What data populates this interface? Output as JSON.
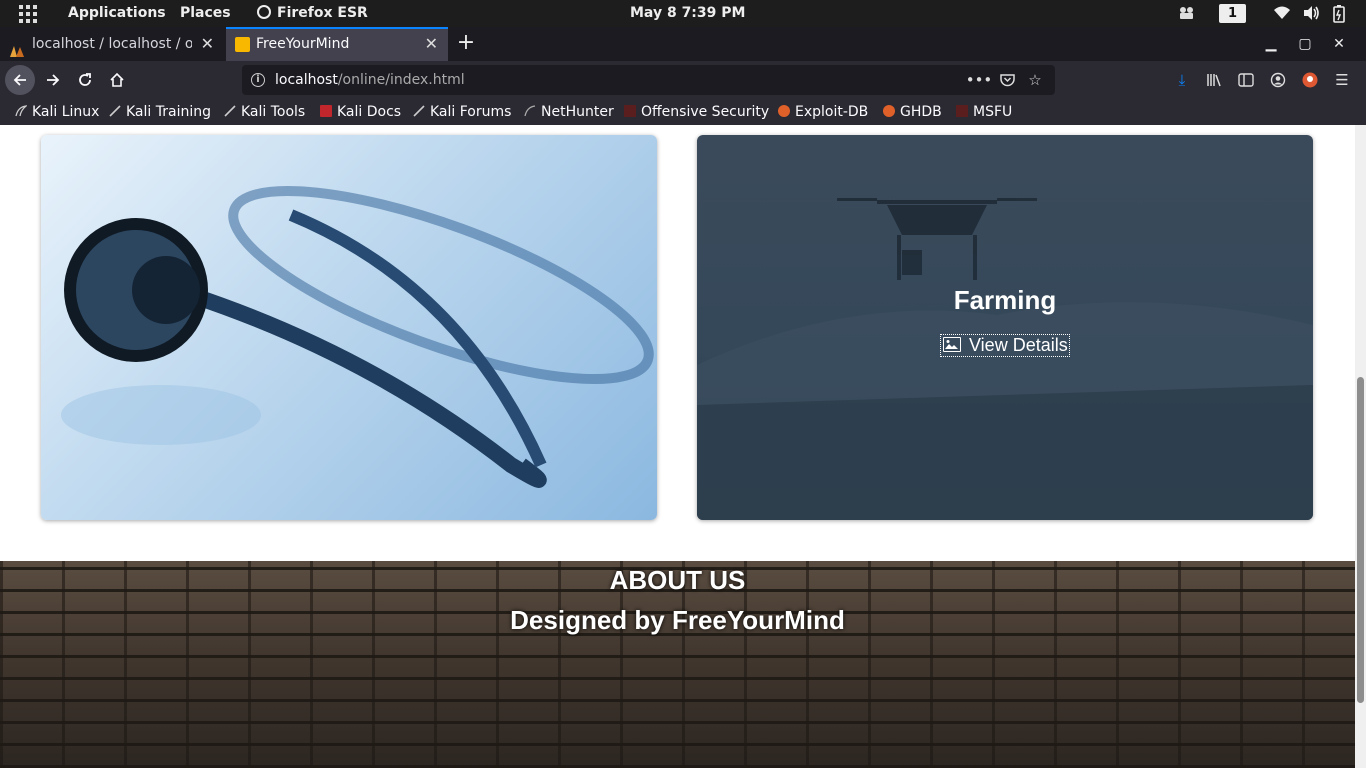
{
  "topbar": {
    "applications": "Applications",
    "places": "Places",
    "app_name": "Firefox ESR",
    "clock": "May 8   7:39 PM",
    "workspace": "1"
  },
  "tabs": [
    {
      "title": "localhost / localhost / online",
      "active": false
    },
    {
      "title": "FreeYourMind",
      "active": true
    }
  ],
  "nav": {
    "url_host": "localhost",
    "url_path": "/online/index.html"
  },
  "bookmarks": [
    {
      "label": "Kali Linux",
      "icon": "kali-dragon-icon"
    },
    {
      "label": "Kali Training",
      "icon": "kali-dragon-icon"
    },
    {
      "label": "Kali Tools",
      "icon": "kali-dragon-icon"
    },
    {
      "label": "Kali Docs",
      "icon": "kali-docs-icon"
    },
    {
      "label": "Kali Forums",
      "icon": "kali-dragon-icon"
    },
    {
      "label": "NetHunter",
      "icon": "nethunter-icon"
    },
    {
      "label": "Offensive Security",
      "icon": "offsec-icon"
    },
    {
      "label": "Exploit-DB",
      "icon": "exploitdb-icon"
    },
    {
      "label": "GHDB",
      "icon": "ghdb-icon"
    },
    {
      "label": "MSFU",
      "icon": "offsec-icon"
    }
  ],
  "cards": {
    "right_title": "Farming",
    "right_button": "View Details"
  },
  "about": {
    "heading": "ABOUT US",
    "credit": "Designed by FreeYourMind"
  },
  "colors": {
    "accent": "#0a84ff",
    "tab_active_bg": "#42414d",
    "toolbar_bg": "#2b2a33",
    "tabstrip_bg": "#1c1b22"
  }
}
